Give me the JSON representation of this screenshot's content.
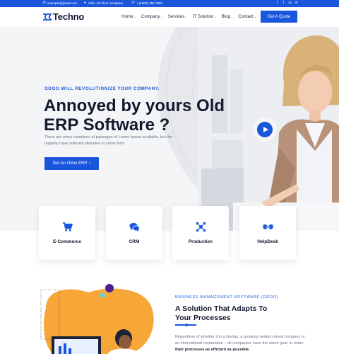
{
  "topbar": {
    "email": "example@gmail.com",
    "address": "24/5, 1st Floor, Kurigram",
    "phone": "+ (1800) 456 7890",
    "social": [
      "facebook-icon",
      "twitter-icon",
      "instagram-icon",
      "linkedin-icon"
    ]
  },
  "header": {
    "logo_text": "Techno",
    "nav": [
      "Home",
      "Company",
      "Services",
      "IT Solution",
      "Blog",
      "Contact"
    ],
    "quote_label": "Get A Quote"
  },
  "hero": {
    "kicker": "ODOO WILL REVOLUTIONIZE YOUR COMPANY.",
    "title_line1": "Annoyed by yours Old",
    "title_line2": "ERP Software ?",
    "description": "There are many variations of passages of Lorem Ipsum available, but the majority have suffered alteration in some form",
    "button_label": "Get An Odoo ERP"
  },
  "cards": [
    {
      "label": "E-Commerce",
      "icon": "cart-icon"
    },
    {
      "label": "CRM",
      "icon": "chat-icon"
    },
    {
      "label": "Production",
      "icon": "network-icon"
    },
    {
      "label": "HelpDesk",
      "icon": "handshake-icon"
    }
  ],
  "about": {
    "kicker": "BUSINESS MANAGEMENT SOFTWARE (ODOO)",
    "title_line1": "A Solution That Adapts To",
    "title_line2": "Your Processes",
    "desc_start": "Regardless of whether it is a startup, a growing medium-sized company or an international corporation – all companies have the same goal: to make",
    "desc_bold": "their processes as efficient as possible."
  },
  "colors": {
    "brand": "#1a56db",
    "dark": "#141a2e",
    "orange": "#f7a738"
  }
}
